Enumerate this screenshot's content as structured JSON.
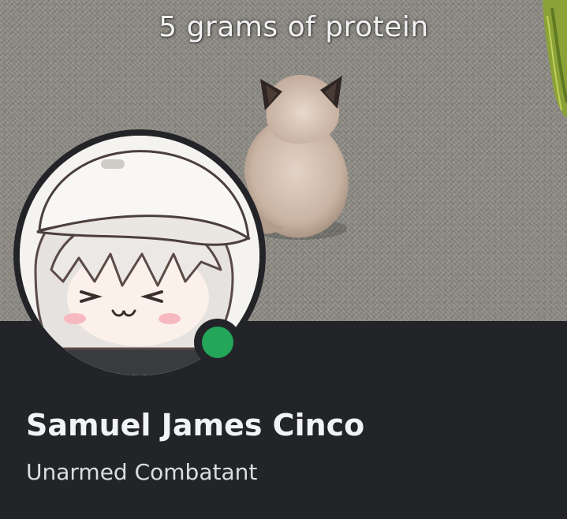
{
  "banner": {
    "caption": "5 grams of protein",
    "image_subject": "kitten"
  },
  "profile": {
    "display_name": "Samuel James Cinco",
    "subtitle": "Unarmed Combatant",
    "status": "online"
  },
  "colors": {
    "card_background": "#232428",
    "status_online": "#23a55a",
    "name_text": "#f2f3f5",
    "subtitle_text": "#dbdee1",
    "carpet": "#8e8b84"
  },
  "icons": {
    "status": "online-status-icon"
  }
}
